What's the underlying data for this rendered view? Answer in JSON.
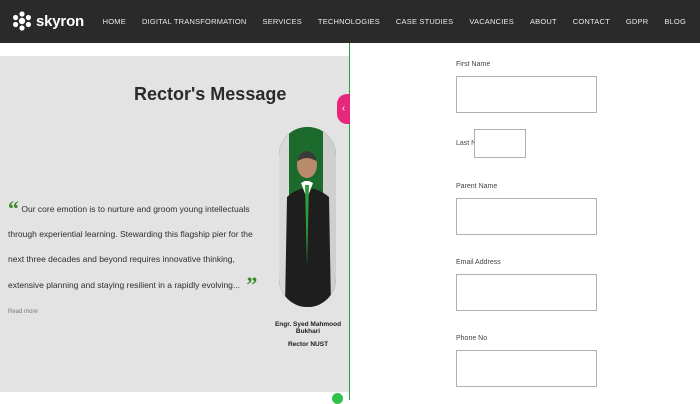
{
  "header": {
    "brand": "skyron",
    "nav": [
      "HOME",
      "DIGITAL TRANSFORMATION",
      "SERVICES",
      "TECHNOLOGIES",
      "CASE STUDIES",
      "VACANCIES",
      "ABOUT",
      "CONTACT",
      "GDPR",
      "BLOG"
    ]
  },
  "rector": {
    "title": "Rector's Message",
    "quote": "Our core emotion is to nurture and groom young intellectuals through experiential learning. Stewarding this flagship pier for the next three decades and beyond requires innovative thinking, extensive planning and staying resilient in a rapidly evolving...",
    "quote_tag": "Read more",
    "name": "Engr. Syed Mahmood Bukhari",
    "role": "Rector NUST"
  },
  "form": {
    "first_name_label": "First Name",
    "last_name_label": "Last Name",
    "parent_name_label": "Parent Name",
    "email_label": "Email Address",
    "phone_label": "Phone No"
  },
  "colors": {
    "header_bg": "#2a2a2a",
    "accent_pink": "#e6287a",
    "accent_green": "#2f9e3a"
  }
}
